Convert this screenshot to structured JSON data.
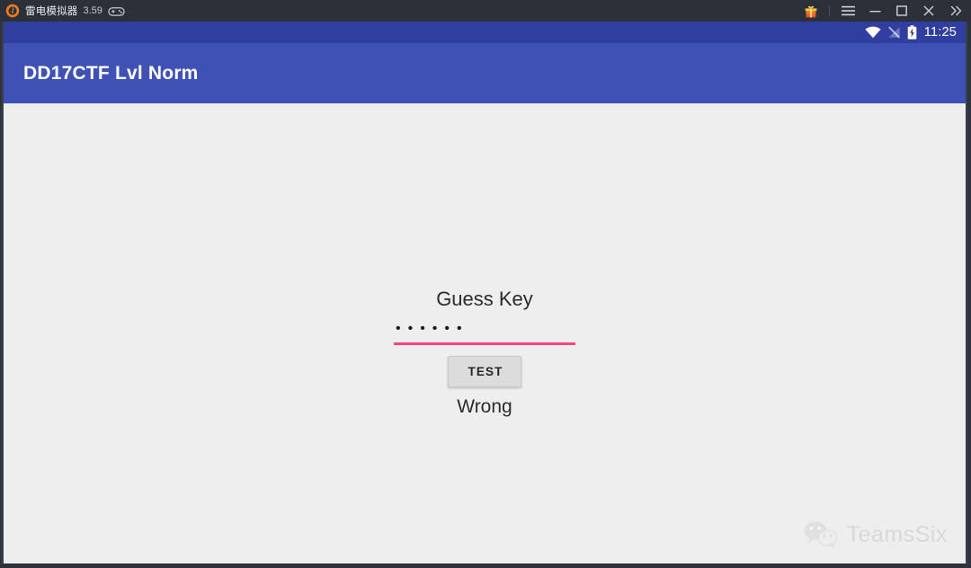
{
  "window": {
    "app_name": "雷电模拟器",
    "version": "3.59",
    "logo_icon": "ldplayer-logo-icon",
    "gamepad_icon": "gamepad-icon",
    "controls": {
      "gift": {
        "label": "gift-icon",
        "tooltip": "Gift"
      },
      "menu": {
        "label": "☰"
      },
      "minimize": {
        "label": "—"
      },
      "maximize": {
        "label": "□"
      },
      "close": {
        "label": "✕"
      },
      "expand": {
        "label": "»"
      }
    }
  },
  "status_bar": {
    "wifi_icon": "wifi-icon",
    "signal_icon": "signal-off-icon",
    "battery_icon": "battery-charging-icon",
    "clock": "11:25"
  },
  "app_bar": {
    "title": "DD17CTF Lvl Norm",
    "background": "#3f51b5",
    "status_background": "#303f9f"
  },
  "form": {
    "label": "Guess Key",
    "input": {
      "value": "••••••",
      "placeholder": "",
      "char_count": 6,
      "underline_color": "#f8467c"
    },
    "button_label": "TEST",
    "result": "Wrong"
  },
  "watermark": {
    "text": "TeamsSix",
    "icon": "wechat-icon"
  }
}
